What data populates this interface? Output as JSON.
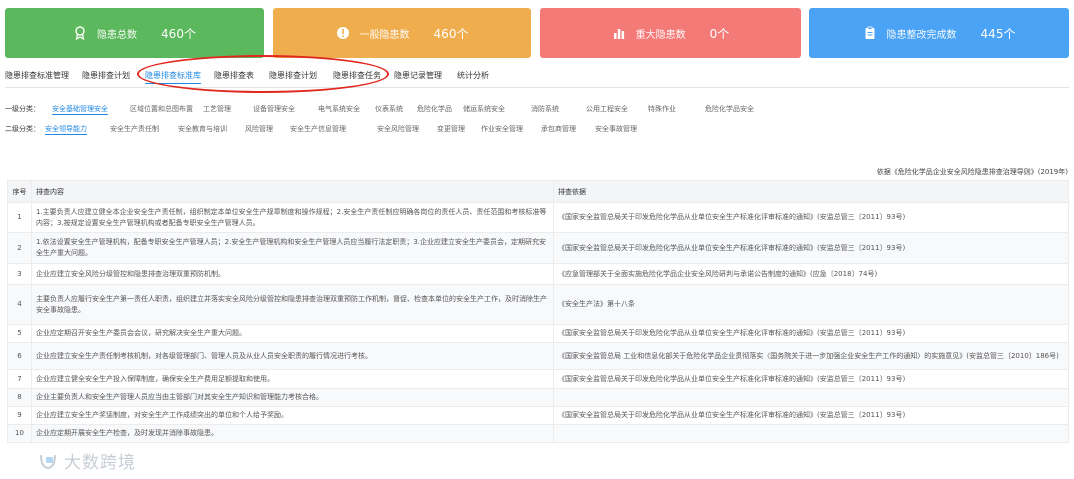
{
  "colors": {
    "green": "#5cb85c",
    "orange": "#f0ad4e",
    "red": "#f47a78",
    "blue": "#4aa3f4",
    "accent": "#1e88e5",
    "annotation": "#e0281f"
  },
  "cards": [
    {
      "icon": "award-icon",
      "label": "隐患总数",
      "value": "460个"
    },
    {
      "icon": "alert-icon",
      "label": "一般隐患数",
      "value": "460个"
    },
    {
      "icon": "bar-chart-icon",
      "label": "重大隐患数",
      "value": "0个"
    },
    {
      "icon": "clipboard-icon",
      "label": "隐患整改完成数",
      "value": "445个"
    }
  ],
  "tabs": [
    "隐患排查标准管理",
    "隐患排查计划",
    "隐患排查标准库",
    "隐患排查表",
    "隐患排查计划",
    "隐患排查任务",
    "隐患记录管理",
    "统计分析"
  ],
  "filters": {
    "level1_label": "一级分类：",
    "level1": [
      "安全基础管理安全",
      "区域位置和总图布置",
      "工艺管理",
      "设备管理安全",
      "电气系统安全",
      "仪表系统",
      "危险化学品",
      "储运系统安全",
      "消防系统",
      "公用工程安全",
      "特殊作业",
      "危险化学品安全"
    ],
    "level2_label": "二级分类：",
    "level2": [
      "安全领导能力",
      "安全生产责任制",
      "安全教育与培训",
      "风险管理",
      "安全生产信息管理",
      "安全风险管理",
      "变更管理",
      "作业安全管理",
      "承包商管理",
      "安全事故管理"
    ]
  },
  "basis_note": "依据《危险化学品企业安全风险隐患排查治理导则》(2019年)",
  "table": {
    "headers": [
      "序号",
      "排查内容",
      "排查依据"
    ],
    "rows": [
      {
        "no": "1",
        "content": "1.主要负责人应建立健全本企业安全生产责任制，组织制定本单位安全生产规章制度和操作规程；2.安全生产责任制应明确各岗位的责任人员、责任范围和考核标准等内容；3.按规定设置安全生产管理机构或者配备专职安全生产管理人员。",
        "basis": "《国家安全监管总局关于印发危险化学品从业单位安全生产标准化评审标准的通知》(安监总管三〔2011〕93号)"
      },
      {
        "no": "2",
        "content": "1.依法设置安全生产管理机构，配备专职安全生产管理人员；2.安全生产管理机构和安全生产管理人员应当履行法定职责；3.企业应建立安全生产委员会，定期研究安全生产重大问题。",
        "basis": "《国家安全监管总局关于印发危险化学品从业单位安全生产标准化评审标准的通知》(安监总管三〔2011〕93号)"
      },
      {
        "no": "3",
        "content": "企业应建立安全风险分级管控和隐患排查治理双重预防机制。",
        "basis": "《应急管理部关于全面实施危险化学品企业安全风险研判与承诺公告制度的通知》(应急〔2018〕74号)"
      },
      {
        "no": "4",
        "content": "主要负责人应履行安全生产第一责任人职责，组织建立并落实安全风险分级管控和隐患排查治理双重预防工作机制，督促、检查本单位的安全生产工作，及时消除生产安全事故隐患。",
        "basis": "《安全生产法》第十八条"
      },
      {
        "no": "5",
        "content": "企业应定期召开安全生产委员会会议，研究解决安全生产重大问题。",
        "basis": "《国家安全监管总局关于印发危险化学品从业单位安全生产标准化评审标准的通知》(安监总管三〔2011〕93号)"
      },
      {
        "no": "6",
        "content": "企业应建立安全生产责任制考核机制，对各级管理部门、管理人员及从业人员安全职责的履行情况进行考核。",
        "basis": "《国家安全监管总局 工业和信息化部关于危险化学品企业贯彻落实〈国务院关于进一步加强企业安全生产工作的通知〉的实施意见》(安监总管三〔2010〕186号)"
      },
      {
        "no": "7",
        "content": "企业应建立健全安全生产投入保障制度，确保安全生产费用足额提取和使用。",
        "basis": "《国家安全监管总局关于印发危险化学品从业单位安全生产标准化评审标准的通知》(安监总管三〔2011〕93号)"
      },
      {
        "no": "8",
        "content": "企业主要负责人和安全生产管理人员应当由主管部门对其安全生产知识和管理能力考核合格。",
        "basis": ""
      },
      {
        "no": "9",
        "content": "企业应建立安全生产奖惩制度，对安全生产工作成绩突出的单位和个人给予奖励。",
        "basis": "《国家安全监管总局关于印发危险化学品从业单位安全生产标准化评审标准的通知》(安监总管三〔2011〕93号)"
      },
      {
        "no": "10",
        "content": "企业应定期开展安全生产检查，及时发现并消除事故隐患。",
        "basis": ""
      }
    ]
  },
  "watermark": {
    "text": "大数跨境"
  }
}
